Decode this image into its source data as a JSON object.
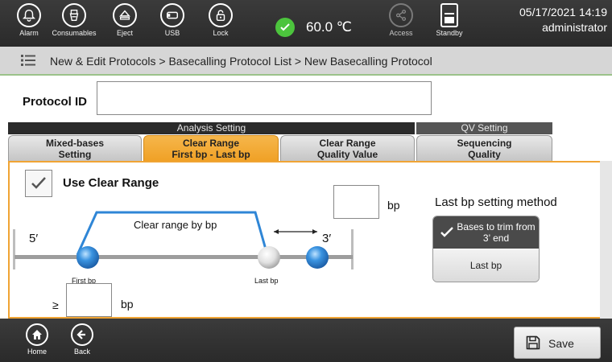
{
  "topbar": {
    "buttons": [
      {
        "label": "Alarm",
        "icon": "bell-icon"
      },
      {
        "label": "Consumables",
        "icon": "consumables-icon"
      },
      {
        "label": "Eject",
        "icon": "eject-icon"
      },
      {
        "label": "USB",
        "icon": "usb-icon"
      },
      {
        "label": "Lock",
        "icon": "lock-icon"
      },
      {
        "label": "Access",
        "icon": "share-icon"
      },
      {
        "label": "Standby",
        "icon": "standby-icon"
      }
    ],
    "temperature": "60.0 ℃",
    "date": "05/17/2021 14:19",
    "user": "administrator"
  },
  "breadcrumb": "New & Edit Protocols > Basecalling Protocol List > New Basecalling Protocol",
  "protocol": {
    "label": "Protocol ID",
    "value": ""
  },
  "tab_groups": {
    "analysis": "Analysis Setting",
    "qv": "QV Setting"
  },
  "tabs": [
    {
      "line1": "Mixed-bases",
      "line2": "Setting"
    },
    {
      "line1": "Clear Range",
      "line2": "First bp - Last bp"
    },
    {
      "line1": "Clear Range",
      "line2": "Quality Value"
    },
    {
      "line1": "Sequencing",
      "line2": "Quality"
    }
  ],
  "active_tab": 1,
  "clear_range": {
    "use_label": "Use Clear Range",
    "checked": true,
    "bp_unit": "bp",
    "last_bp_value": "",
    "first_bp_value": "",
    "ge_symbol": "≥"
  },
  "diagram": {
    "five_prime": "5′",
    "three_prime": "3′",
    "range_label": "Clear range by bp",
    "first_bp": "First bp",
    "last_bp": "Last bp"
  },
  "method": {
    "label": "Last bp setting method",
    "option_trim": "Bases to trim from 3’ end",
    "option_last": "Last bp",
    "selected": "trim"
  },
  "bottombar": {
    "home": "Home",
    "back": "Back",
    "save": "Save"
  },
  "colors": {
    "accent": "#f0a434",
    "ok_green": "#4cc43d",
    "bead_blue": "#2f86d6"
  }
}
